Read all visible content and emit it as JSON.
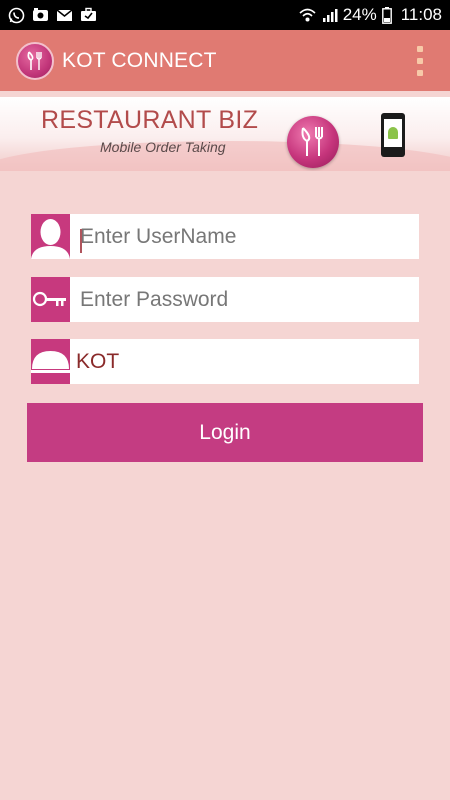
{
  "status_bar": {
    "battery": "24%",
    "time": "11:08",
    "icons": [
      "whatsapp-icon",
      "camera-icon",
      "mail-icon",
      "briefcase-icon",
      "wifi-icon",
      "signal-icon",
      "battery-icon"
    ]
  },
  "app_bar": {
    "title": "KOT CONNECT",
    "logo_icon": "restaurant-logo-icon",
    "menu_icon": "overflow-menu-icon"
  },
  "banner": {
    "title": "RESTAURANT BIZ",
    "subtitle": "Mobile Order Taking"
  },
  "form": {
    "username": {
      "value": "",
      "placeholder": "Enter UserName",
      "icon": "user-icon"
    },
    "password": {
      "value": "",
      "placeholder": "Enter Password",
      "icon": "key-icon"
    },
    "kot": {
      "value": "KOT",
      "icon": "cloche-icon"
    },
    "login_label": "Login"
  },
  "colors": {
    "status_bar": "#000000",
    "app_bar": "#e07a72",
    "background": "#f5d5d3",
    "accent": "#c43c82"
  }
}
